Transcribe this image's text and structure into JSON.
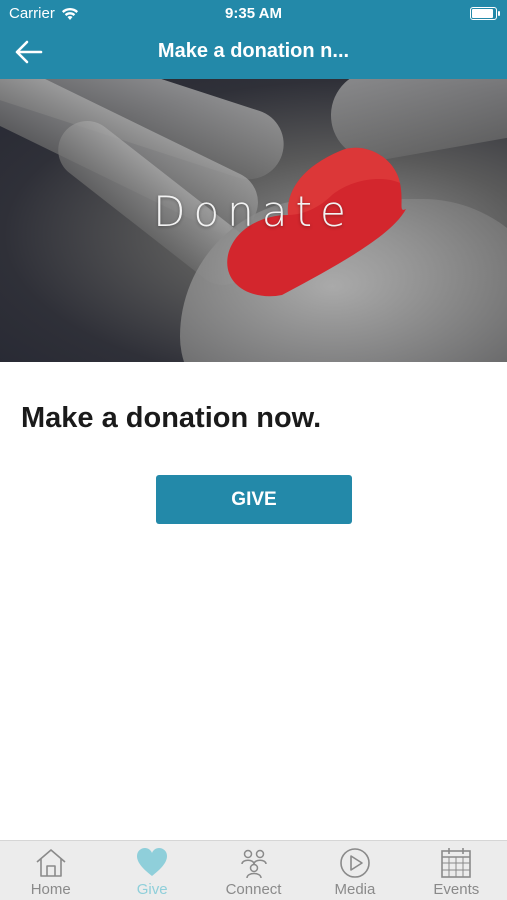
{
  "colors": {
    "brand": "#2389a9",
    "active_tab": "#8fcfda",
    "heart": "#d3262d"
  },
  "status_bar": {
    "carrier": "Carrier",
    "time": "9:35 AM"
  },
  "nav": {
    "title": "Make a donation n...",
    "back_icon": "arrow-left-icon"
  },
  "hero": {
    "text": "Donate"
  },
  "content": {
    "headline": "Make a donation now.",
    "button_label": "GIVE"
  },
  "tabs": [
    {
      "label": "Home",
      "icon": "home-icon",
      "active": false
    },
    {
      "label": "Give",
      "icon": "heart-icon",
      "active": true
    },
    {
      "label": "Connect",
      "icon": "people-icon",
      "active": false
    },
    {
      "label": "Media",
      "icon": "play-icon",
      "active": false
    },
    {
      "label": "Events",
      "icon": "calendar-icon",
      "active": false
    }
  ]
}
